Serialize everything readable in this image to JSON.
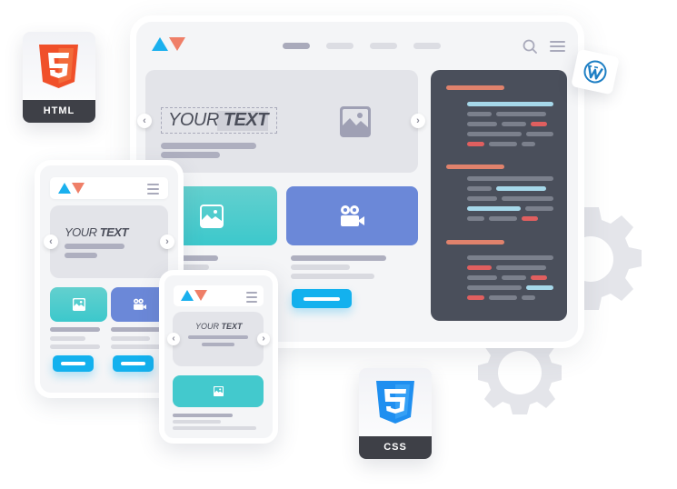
{
  "badges": {
    "html": {
      "label": "HTML",
      "icon": "html5-icon",
      "color": "#f0502a"
    },
    "css": {
      "label": "CSS",
      "icon": "css3-icon",
      "color": "#1f8ff0"
    },
    "wordpress": {
      "icon": "wordpress-icon",
      "color": "#1e7fc4"
    }
  },
  "desktop": {
    "nav": {
      "items": [
        "nav-1",
        "nav-2",
        "nav-3",
        "nav-4"
      ],
      "active_index": 0
    },
    "hero": {
      "text_light": "YOUR",
      "text_bold": "TEXT"
    },
    "cards": [
      {
        "type": "image",
        "icon": "image-icon"
      },
      {
        "type": "video",
        "icon": "video-camera-icon"
      }
    ]
  },
  "tablet": {
    "hero": {
      "text_light": "YOUR",
      "text_bold": "TEXT"
    }
  },
  "phone": {
    "hero": {
      "text_light": "YOUR",
      "text_bold": "TEXT"
    }
  },
  "colors": {
    "accent_blue": "#13b1ee",
    "logo_blue": "#1ab0ee",
    "logo_orange": "#ef7f68",
    "teal": "#3cc8cc",
    "purple": "#6b88d8",
    "code_bg": "#4a4f5b"
  }
}
